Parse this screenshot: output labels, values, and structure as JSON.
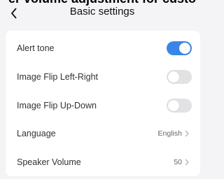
{
  "banner": {
    "text": "er volume adjustment for custo"
  },
  "header": {
    "title": "Basic settings",
    "back_icon": "chevron-left-icon"
  },
  "settings": [
    {
      "label": "Alert tone",
      "type": "toggle",
      "on": true
    },
    {
      "label": "Image Flip Left-Right",
      "type": "toggle",
      "on": false
    },
    {
      "label": "Image Flip Up-Down",
      "type": "toggle",
      "on": false
    },
    {
      "label": "Language",
      "type": "link",
      "value": "English"
    },
    {
      "label": "Speaker Volume",
      "type": "link",
      "value": "50"
    }
  ],
  "colors": {
    "toggle_on": "#3a86e8",
    "toggle_off": "#e2e2e4",
    "background": "#f4f4f6"
  }
}
